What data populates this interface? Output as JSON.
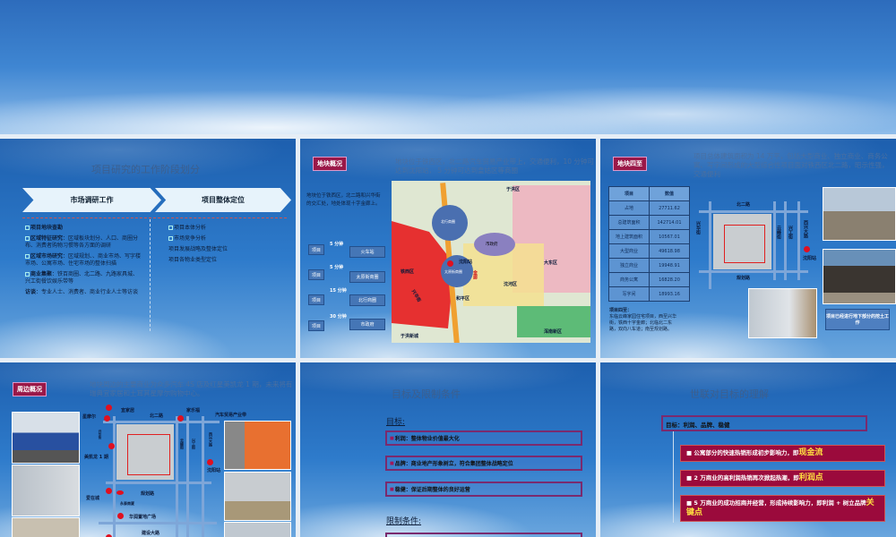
{
  "slide1": {
    "title": "项目研究的工作阶段划分",
    "chevrons": [
      "市场调研工作",
      "项目整体定位"
    ],
    "left_items": [
      {
        "bold": "项目地块查勘",
        "text": ""
      },
      {
        "bold": "区域特征研究",
        "text": "：区域板块划分、人口、商圈分布、消费者购物习惯等各方面的调研"
      },
      {
        "bold": "区域市场研究",
        "text": "：区域规划、、商业市场、写字楼市场、公寓市场、住宅市场的整体扫描"
      },
      {
        "bold": "商业集聚",
        "text": "：铁百商圈、北二路、九路家具城、兴工街餐饮娱乐带等"
      },
      {
        "bold": "访谈",
        "text": "：专业人士、消费者、商业行业人士等访谈"
      }
    ],
    "right_items": [
      "项目本体分析",
      "市场竞争分析",
      "项目发展战略及整体定位",
      "项目各物业类型定位"
    ]
  },
  "slide2": {
    "badge": "地块概况",
    "header": "地块位于铁西区，北二路汽车贸易产业带上，交通便利，10 分钟可达到沈阳站， 5 分钟可达到皇姑区等商圈",
    "note": "地块位于铁西区，北二路和兴华街的交汇处，地处体现十字金廊上。",
    "routes": [
      {
        "from": "项目",
        "time": "5 分钟",
        "to": "火车站"
      },
      {
        "from": "项目",
        "time": "5 分钟",
        "to": "太原街商圈"
      },
      {
        "from": "项目",
        "time": "15 分钟",
        "to": "北行商圈"
      },
      {
        "from": "项目",
        "time": "30 分钟",
        "to": "市政府"
      }
    ],
    "map_labels": {
      "north": "北行商圈",
      "gov": "市政府",
      "station": "沈阳站",
      "taiyuan": "太原街商圈",
      "tiexi": "铁西区",
      "shenhe": "沈河区",
      "heping": "和平区",
      "dadong": "大东区",
      "yuhong": "于洪区",
      "yuhong_new": "于洪新城",
      "hunnan": "浑南新区",
      "road": "兴华街",
      "cross": "金廊"
    }
  },
  "slide3": {
    "badge": "地块四至",
    "header": "项目总体建筑面积为 14 万平，包括大型商业、独立商业、商务公寓、写字间形成的大型综合性项目面对铁西区北二路，昭示性强，交通便利",
    "table": {
      "headers": [
        "项目",
        "数值"
      ],
      "rows": [
        [
          "占地",
          "27711.62"
        ],
        [
          "总建筑面积",
          "142714.01"
        ],
        [
          "地上建筑面积",
          "10567.01"
        ],
        [
          "大型商业",
          "49618.98"
        ],
        [
          "独立商业",
          "19948.91"
        ],
        [
          "商务公寓",
          "16828.20"
        ],
        [
          "写字间",
          "18993.16"
        ]
      ]
    },
    "note_title": "项目四至：",
    "note": "东临云峰家园住宅项目，西至兴华街，铁西十字金廊；北临北二东路，双向八车道；南至规划路。",
    "roads": {
      "north": "北二路",
      "south": "规划路",
      "west": "兴华街",
      "r1": "云峰街",
      "r2": "兴工街",
      "r3": "西兴大路",
      "station": "沈阳站"
    },
    "caption": "项目已经进行地下部分的挖土工作"
  },
  "slide4": {
    "badge": "周边概况",
    "header": "地块周边的主要商业为众多汽车 4S 店及红星美凯龙 1 期，未来将有瑞典宜家居和土耳其星摩尔购物中心。",
    "labels": {
      "ikea": "宜家居",
      "star": "星摩尔",
      "north": "北二路",
      "jiale": "家乐福",
      "auto": "汽车贸易产业带",
      "meikailong": "美凯龙 1 期",
      "station": "沈阳站",
      "aizai": "爱在城",
      "guihua": "规划路",
      "yonghang": "永泰商厦",
      "hualian": "华润置地广场",
      "jianshe": "建设大路",
      "xinghua": "兴华街",
      "yunfeng": "云峰街",
      "xinggong": "兴工街",
      "xixing": "西兴大路"
    }
  },
  "slide5": {
    "title": "目标及限制条件",
    "goals_heading": "目标:",
    "goals": [
      "利润：整体物业价值最大化",
      "品牌：商业地产形象树立，符合集团整体战略定位",
      "稳健：保证后期整体的良好运营"
    ],
    "limits_heading": "限制条件:"
  },
  "slide6": {
    "title": "世联对目标的理解",
    "goal": "目标：利润、品牌、稳健",
    "points": [
      {
        "text": "公寓部分的快速热销形成初步影响力，即",
        "key": "现金流"
      },
      {
        "text": "2 万商业的高利润热销再次掀起热潮，即",
        "key": "利润点"
      },
      {
        "text": "5 万商业的成功招商并经营，形成持续影响力，即利润 + 树立品牌",
        "key": "关键点"
      }
    ]
  },
  "colors": {
    "badge": "#9a1848",
    "slide_blue": "#2e7bcb",
    "key_yellow": "#ffe040"
  }
}
